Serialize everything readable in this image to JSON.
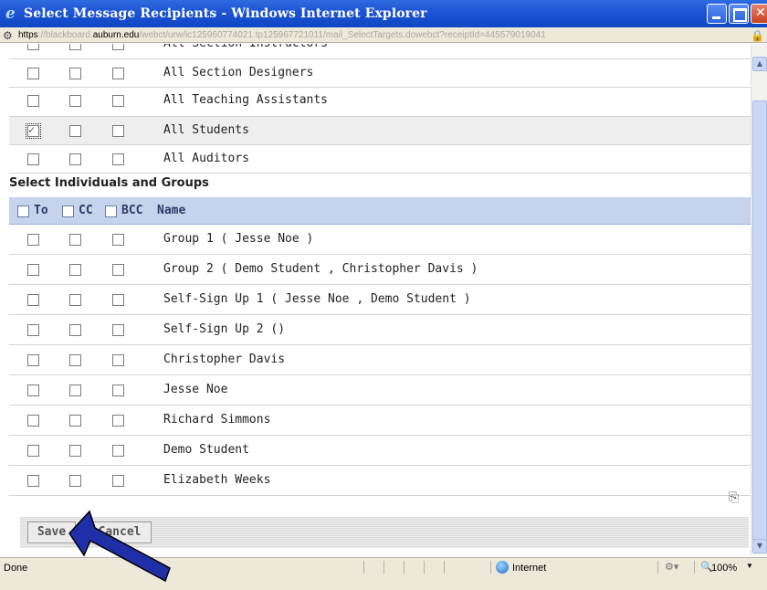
{
  "window": {
    "title": "Select Message Recipients - Windows Internet Explorer",
    "url_protocol": "https",
    "url_before_domain": "://blackboard.",
    "url_domain": "auburn.edu",
    "url_path": "/webct/urw/lc125960774021.tp125967721011/mail_SelectTargets.dowebct?receiptId=445579019041"
  },
  "roles": {
    "partial_label": "All Section Instructors",
    "rows": [
      {
        "label": "All Section Designers",
        "to": false
      },
      {
        "label": "All Teaching Assistants",
        "to": false
      },
      {
        "label": "All Students",
        "to": true
      },
      {
        "label": "All Auditors",
        "to": false
      }
    ]
  },
  "section_title": "Select Individuals and Groups",
  "table_header": {
    "to": "To",
    "cc": "CC",
    "bcc": "BCC",
    "name": "Name"
  },
  "recipients": [
    "Group 1 ( Jesse Noe )",
    "Group 2 ( Demo Student , Christopher Davis )",
    "Self-Sign Up 1 ( Jesse Noe , Demo Student )",
    "Self-Sign Up 2 ()",
    "Christopher Davis",
    "Jesse Noe",
    "Richard Simmons",
    "Demo Student",
    "Elizabeth Weeks"
  ],
  "buttons": {
    "save": "Save",
    "cancel": "Cancel"
  },
  "status": {
    "text": "Done",
    "zone": "Internet",
    "zoom": "100%"
  },
  "colors": {
    "title_bar": "#1d55d4",
    "header_row": "#c6d3ed",
    "arrow": "#1f2fa8"
  }
}
